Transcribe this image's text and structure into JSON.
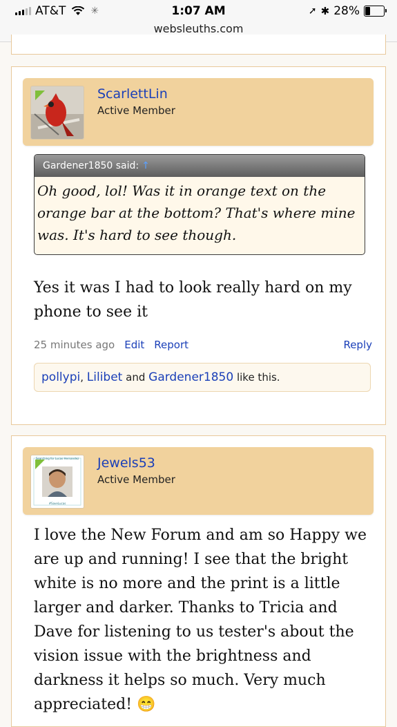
{
  "status": {
    "carrier": "AT&T",
    "time": "1:07 AM",
    "url": "websleuths.com",
    "battery": "28%",
    "battery_level": 0.28
  },
  "post1": {
    "username": "ScarlettLin",
    "user_title": "Active Member",
    "quote": {
      "author_said": "Gardener1850 said:",
      "arrow": "↑",
      "text": "Oh good, lol! Was it in orange text on the orange bar at the bottom? That's where mine was. It's hard to see though."
    },
    "message": "Yes it was I had to look really hard on my phone to see it",
    "time_ago": "25 minutes ago",
    "edit_label": "Edit",
    "report_label": "Report",
    "reply_label": "Reply",
    "likes": {
      "user1": "pollypi",
      "sep": ",",
      "user2": "Lilibet",
      "and": "and",
      "user3": "Gardener1850",
      "suffix": "like this."
    }
  },
  "post2": {
    "username": "Jewels53",
    "user_title": "Active Member",
    "avatar_caption_top": "Searching for Lucas Hernandez",
    "avatar_caption_bottom": "#SaveLucas",
    "message": "I love the New Forum and am so Happy we are up and running! I see that the bright white is no more and the print is a little larger and darker. Thanks to Tricia and Dave for listening to us tester's about the vision issue with the brightness and darkness it helps so much. Very much appreciated! 😁"
  },
  "colors": {
    "userbar": "#f1d29d",
    "link": "#1a3fb8",
    "card_border": "#e8c89a"
  }
}
